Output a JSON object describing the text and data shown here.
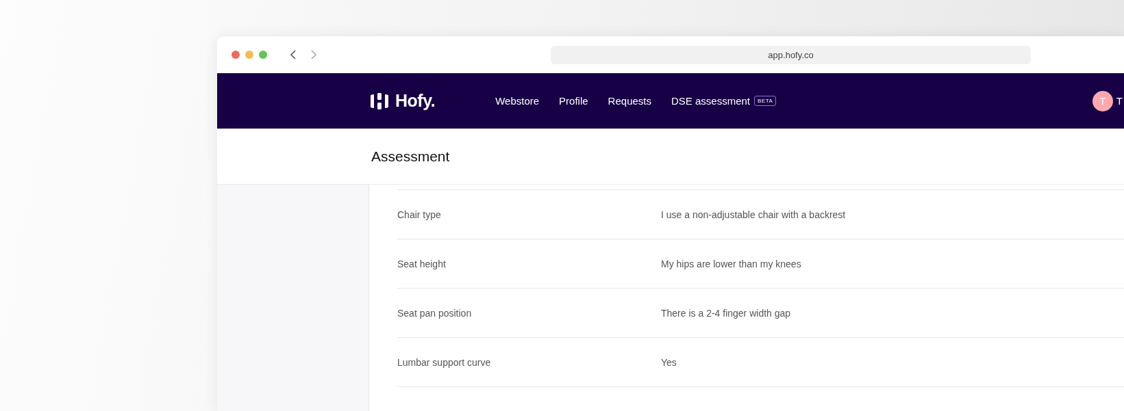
{
  "browser": {
    "url": "app.hofy.co"
  },
  "nav": {
    "logo": "Hofy.",
    "items": [
      {
        "label": "Webstore",
        "selected": false
      },
      {
        "label": "Profile",
        "selected": false
      },
      {
        "label": "Requests",
        "selected": false
      },
      {
        "label": "DSE assessment",
        "selected": false,
        "badge": "BETA"
      }
    ],
    "user": {
      "initial": "T",
      "name": "T"
    }
  },
  "page": {
    "title": "Assessment"
  },
  "answers": [
    {
      "question": "Chair type",
      "answer": "I use a non-adjustable chair with a backrest"
    },
    {
      "question": "Seat height",
      "answer": "My hips are lower than my knees"
    },
    {
      "question": "Seat pan position",
      "answer": "There is a 2-4 finger width gap"
    },
    {
      "question": "Lumbar support curve",
      "answer": "Yes"
    }
  ]
}
